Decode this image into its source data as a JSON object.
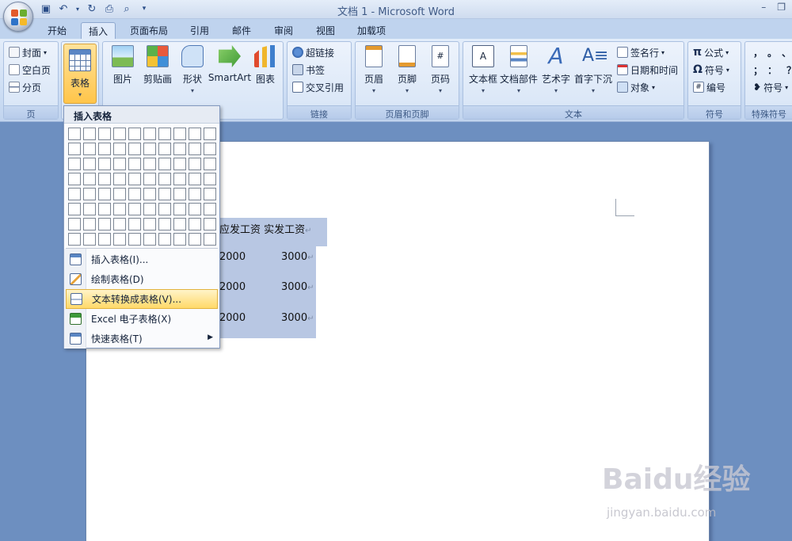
{
  "title": "文档 1 - Microsoft Word",
  "tabs": [
    "开始",
    "插入",
    "页面布局",
    "引用",
    "邮件",
    "审阅",
    "视图",
    "加载项"
  ],
  "ribbon": {
    "page_group": {
      "label": "页",
      "items": [
        "封面",
        "空白页",
        "分页"
      ]
    },
    "table_group": {
      "label": "表格"
    },
    "illustrations": {
      "items": [
        "图片",
        "剪贴画",
        "形状",
        "SmartArt",
        "图表"
      ]
    },
    "links": {
      "label": "链接",
      "items": [
        "超链接",
        "书签",
        "交叉引用"
      ]
    },
    "header_footer": {
      "label": "页眉和页脚",
      "items": [
        "页眉",
        "页脚",
        "页码"
      ]
    },
    "text": {
      "label": "文本",
      "items": [
        "文本框",
        "文档部件",
        "艺术字",
        "首字下沉"
      ],
      "small": [
        "签名行",
        "日期和时间",
        "对象"
      ]
    },
    "symbols": {
      "label": "符号",
      "items": [
        "公式",
        "符号",
        "编号"
      ]
    },
    "special": {
      "label": "特殊符号",
      "items": [
        "符号"
      ]
    }
  },
  "dropdown": {
    "header": "插入表格",
    "menu": [
      "插入表格(I)...",
      "绘制表格(D)",
      "文本转换成表格(V)...",
      "Excel 电子表格(X)",
      "快速表格(T)"
    ]
  },
  "document": {
    "header_row": "应发工资  实发工资",
    "rows": [
      [
        "2000",
        "3000"
      ],
      [
        "2000",
        "3000"
      ],
      [
        "2000",
        "3000"
      ]
    ]
  },
  "watermark": {
    "logo": "Baidu经验",
    "sub": "jingyan.baidu.com"
  }
}
